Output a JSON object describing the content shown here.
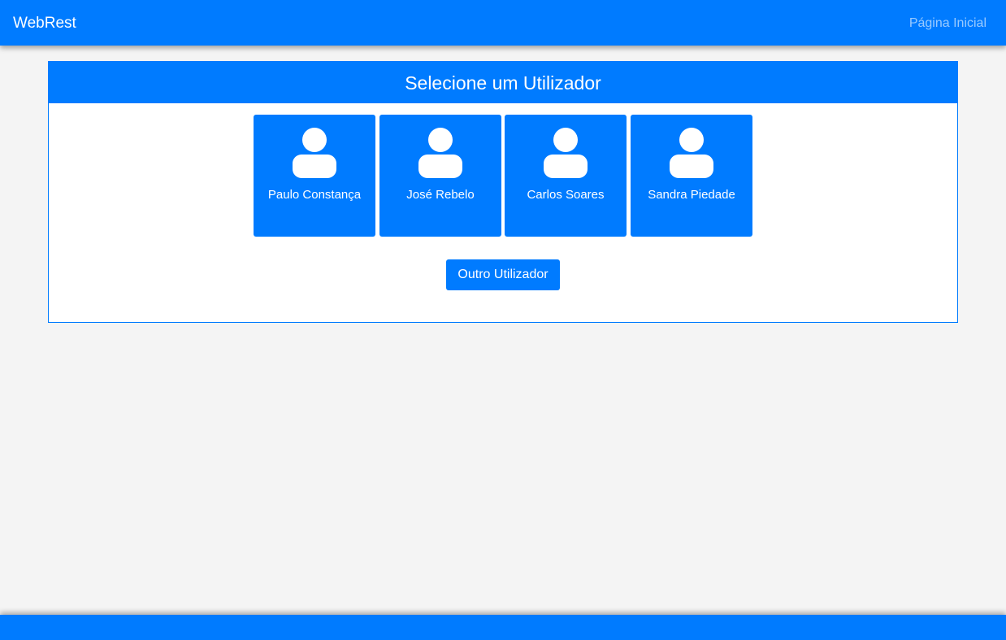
{
  "navbar": {
    "brand": "WebRest",
    "links": [
      {
        "label": "Página Inicial"
      }
    ]
  },
  "panel": {
    "title": "Selecione um Utilizador",
    "users": [
      {
        "name": "Paulo Constança",
        "icon": "user-icon"
      },
      {
        "name": "José Rebelo",
        "icon": "user-icon"
      },
      {
        "name": "Carlos Soares",
        "icon": "user-icon"
      },
      {
        "name": "Sandra Piedade",
        "icon": "user-icon"
      }
    ],
    "other_button_label": "Outro Utilizador"
  },
  "colors": {
    "primary": "#007bff",
    "background": "#f4f4f4",
    "panel_background": "#ffffff",
    "text_on_primary": "#ffffff"
  }
}
